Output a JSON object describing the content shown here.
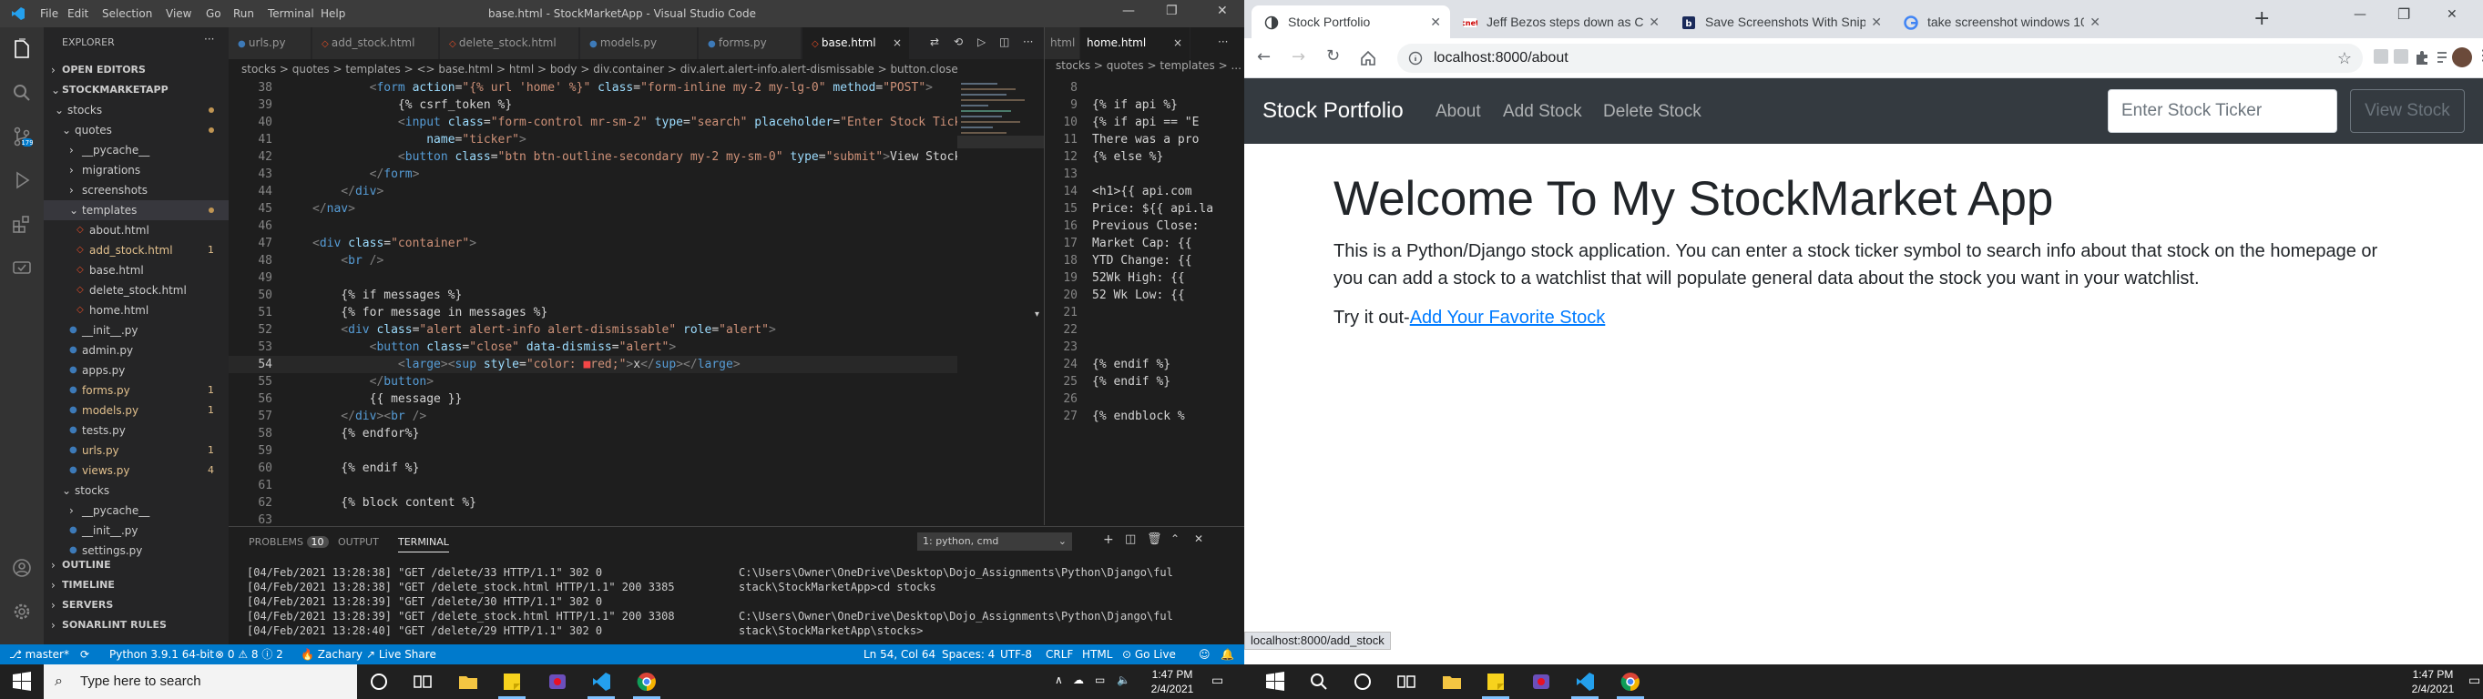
{
  "vscode": {
    "title": "base.html - StockMarketApp - Visual Studio Code",
    "menu": [
      "File",
      "Edit",
      "Selection",
      "View",
      "Go",
      "Run",
      "Terminal",
      "Help"
    ],
    "explorer": {
      "header": "EXPLORER",
      "open_editors": "OPEN EDITORS",
      "project": "STOCKMARKETAPP",
      "tree": [
        {
          "label": "stocks",
          "indent": 1,
          "type": "folder",
          "open": true,
          "dot": true
        },
        {
          "label": "quotes",
          "indent": 2,
          "type": "folder",
          "open": true,
          "dot": true
        },
        {
          "label": "__pycache__",
          "indent": 3,
          "type": "folder"
        },
        {
          "label": "migrations",
          "indent": 3,
          "type": "folder"
        },
        {
          "label": "screenshots",
          "indent": 3,
          "type": "folder"
        },
        {
          "label": "templates",
          "indent": 3,
          "type": "folder",
          "open": true,
          "dot": true,
          "selected": true
        },
        {
          "label": "about.html",
          "indent": 4,
          "type": "html"
        },
        {
          "label": "add_stock.html",
          "indent": 4,
          "type": "html",
          "badge": "1",
          "modified": true
        },
        {
          "label": "base.html",
          "indent": 4,
          "type": "html"
        },
        {
          "label": "delete_stock.html",
          "indent": 4,
          "type": "html"
        },
        {
          "label": "home.html",
          "indent": 4,
          "type": "html"
        },
        {
          "label": "__init__.py",
          "indent": 3,
          "type": "py"
        },
        {
          "label": "admin.py",
          "indent": 3,
          "type": "py"
        },
        {
          "label": "apps.py",
          "indent": 3,
          "type": "py"
        },
        {
          "label": "forms.py",
          "indent": 3,
          "type": "py",
          "badge": "1",
          "modified": true
        },
        {
          "label": "models.py",
          "indent": 3,
          "type": "py",
          "badge": "1",
          "modified": true
        },
        {
          "label": "tests.py",
          "indent": 3,
          "type": "py"
        },
        {
          "label": "urls.py",
          "indent": 3,
          "type": "py",
          "badge": "1",
          "modified": true
        },
        {
          "label": "views.py",
          "indent": 3,
          "type": "py",
          "badge": "4",
          "modified": true
        },
        {
          "label": "stocks",
          "indent": 2,
          "type": "folder",
          "open": true
        },
        {
          "label": "__pycache__",
          "indent": 3,
          "type": "folder"
        },
        {
          "label": "__init__.py",
          "indent": 3,
          "type": "py"
        },
        {
          "label": "settings.py",
          "indent": 3,
          "type": "py"
        }
      ],
      "bottom_sections": [
        "OUTLINE",
        "TIMELINE",
        "SERVERS",
        "SONARLINT RULES"
      ]
    },
    "tabs": [
      {
        "label": "urls.py",
        "kind": "py"
      },
      {
        "label": "add_stock.html",
        "kind": "html"
      },
      {
        "label": "delete_stock.html",
        "kind": "html"
      },
      {
        "label": "models.py",
        "kind": "py"
      },
      {
        "label": "forms.py",
        "kind": "py"
      },
      {
        "label": "base.html",
        "kind": "html",
        "active": true
      }
    ],
    "breadcrumb": "stocks > quotes > templates > <> base.html > html > body > div.container > div.alert.alert-info.alert-dismissable > button.close",
    "code_lines": [
      {
        "n": "38",
        "parts": [
          [
            "t",
            "        "
          ],
          [
            "t",
            "<"
          ],
          [
            "tg",
            "form"
          ],
          [
            "at",
            " action"
          ],
          [
            "tx",
            "="
          ],
          [
            "st",
            "\"{% url 'home' %}\""
          ],
          [
            "at",
            " class"
          ],
          [
            "tx",
            "="
          ],
          [
            "st",
            "\"form-inline my-2 my-lg-0\""
          ],
          [
            "at",
            " method"
          ],
          [
            "tx",
            "="
          ],
          [
            "st",
            "\"POST\""
          ],
          [
            "t",
            ">"
          ]
        ]
      },
      {
        "n": "39",
        "parts": [
          [
            "tx",
            "            {% csrf_token %}"
          ]
        ]
      },
      {
        "n": "40",
        "parts": [
          [
            "t",
            "            <"
          ],
          [
            "tg",
            "input"
          ],
          [
            "at",
            " class"
          ],
          [
            "tx",
            "="
          ],
          [
            "st",
            "\"form-control mr-sm-2\""
          ],
          [
            "at",
            " type"
          ],
          [
            "tx",
            "="
          ],
          [
            "st",
            "\"search\""
          ],
          [
            "at",
            " placeholder"
          ],
          [
            "tx",
            "="
          ],
          [
            "st",
            "\"Enter Stock Ticker\""
          ],
          [
            "at",
            " aria"
          ]
        ]
      },
      {
        "n": "41",
        "parts": [
          [
            "at",
            "                name"
          ],
          [
            "tx",
            "="
          ],
          [
            "st",
            "\"ticker\""
          ],
          [
            "t",
            ">"
          ]
        ]
      },
      {
        "n": "42",
        "parts": [
          [
            "t",
            "            <"
          ],
          [
            "tg",
            "button"
          ],
          [
            "at",
            " class"
          ],
          [
            "tx",
            "="
          ],
          [
            "st",
            "\"btn btn-outline-secondary my-2 my-sm-0\""
          ],
          [
            "at",
            " type"
          ],
          [
            "tx",
            "="
          ],
          [
            "st",
            "\"submit\""
          ],
          [
            "t",
            ">"
          ],
          [
            "tx",
            "View Stock"
          ],
          [
            "t",
            "</"
          ],
          [
            "tg",
            "bu"
          ]
        ]
      },
      {
        "n": "43",
        "parts": [
          [
            "t",
            "        </"
          ],
          [
            "tg",
            "form"
          ],
          [
            "t",
            ">"
          ]
        ]
      },
      {
        "n": "44",
        "parts": [
          [
            "t",
            "    </"
          ],
          [
            "tg",
            "div"
          ],
          [
            "t",
            ">"
          ]
        ]
      },
      {
        "n": "45",
        "parts": [
          [
            "t",
            "</"
          ],
          [
            "tg",
            "nav"
          ],
          [
            "t",
            ">"
          ]
        ]
      },
      {
        "n": "46",
        "parts": []
      },
      {
        "n": "47",
        "parts": [
          [
            "t",
            "<"
          ],
          [
            "tg",
            "div"
          ],
          [
            "at",
            " class"
          ],
          [
            "tx",
            "="
          ],
          [
            "st",
            "\"container\""
          ],
          [
            "t",
            ">"
          ]
        ]
      },
      {
        "n": "48",
        "parts": [
          [
            "t",
            "    <"
          ],
          [
            "tg",
            "br"
          ],
          [
            "t",
            " />"
          ]
        ]
      },
      {
        "n": "49",
        "parts": []
      },
      {
        "n": "50",
        "parts": [
          [
            "tx",
            "    {% if messages %}"
          ]
        ]
      },
      {
        "n": "51",
        "parts": [
          [
            "tx",
            "    {% for message in messages %}"
          ]
        ]
      },
      {
        "n": "52",
        "parts": [
          [
            "t",
            "    <"
          ],
          [
            "tg",
            "div"
          ],
          [
            "at",
            " class"
          ],
          [
            "tx",
            "="
          ],
          [
            "st",
            "\"alert alert-info alert-dismissable\""
          ],
          [
            "at",
            " role"
          ],
          [
            "tx",
            "="
          ],
          [
            "st",
            "\"alert\""
          ],
          [
            "t",
            ">"
          ]
        ]
      },
      {
        "n": "53",
        "parts": [
          [
            "t",
            "        <"
          ],
          [
            "tg",
            "button"
          ],
          [
            "at",
            " class"
          ],
          [
            "tx",
            "="
          ],
          [
            "st",
            "\"close\""
          ],
          [
            "at",
            " data-dismiss"
          ],
          [
            "tx",
            "="
          ],
          [
            "st",
            "\"alert\""
          ],
          [
            "t",
            ">"
          ]
        ]
      },
      {
        "n": "54",
        "hl": true,
        "parts": [
          [
            "t",
            "            <"
          ],
          [
            "tg",
            "large"
          ],
          [
            "t",
            "><"
          ],
          [
            "tg",
            "sup"
          ],
          [
            "at",
            " style"
          ],
          [
            "tx",
            "="
          ],
          [
            "st",
            "\"color: "
          ],
          [
            "red",
            "■"
          ],
          [
            "st",
            "red;\""
          ],
          [
            "t",
            ">"
          ],
          [
            "tx",
            "x"
          ],
          [
            "t",
            "</"
          ],
          [
            "tg",
            "sup"
          ],
          [
            "t",
            "></"
          ],
          [
            "tg",
            "large"
          ],
          [
            "t",
            ">"
          ]
        ]
      },
      {
        "n": "55",
        "parts": [
          [
            "t",
            "        </"
          ],
          [
            "tg",
            "button"
          ],
          [
            "t",
            ">"
          ]
        ]
      },
      {
        "n": "56",
        "parts": [
          [
            "tx",
            "        {{ message }}"
          ]
        ]
      },
      {
        "n": "57",
        "parts": [
          [
            "t",
            "    </"
          ],
          [
            "tg",
            "div"
          ],
          [
            "t",
            "><"
          ],
          [
            "tg",
            "br"
          ],
          [
            "t",
            " />"
          ]
        ]
      },
      {
        "n": "58",
        "parts": [
          [
            "tx",
            "    {% endfor%}"
          ]
        ]
      },
      {
        "n": "59",
        "parts": []
      },
      {
        "n": "60",
        "parts": [
          [
            "tx",
            "    {% endif %}"
          ]
        ]
      },
      {
        "n": "61",
        "parts": []
      },
      {
        "n": "62",
        "parts": [
          [
            "tx",
            "    {% block content %}"
          ]
        ]
      },
      {
        "n": "63",
        "parts": []
      }
    ],
    "split_tabs": [
      "html",
      "home.html"
    ],
    "split_breadcrumb": "stocks > quotes > templates > ...",
    "split_lines": [
      {
        "n": "8",
        "text": ""
      },
      {
        "n": "9",
        "text": "{% if api %}"
      },
      {
        "n": "10",
        "text": "{% if api == \"E"
      },
      {
        "n": "11",
        "text": "There was a pro"
      },
      {
        "n": "12",
        "text": "{% else %}"
      },
      {
        "n": "13",
        "text": ""
      },
      {
        "n": "14",
        "text": "<h1>{{ api.com"
      },
      {
        "n": "15",
        "text": "Price: ${{ api.la"
      },
      {
        "n": "16",
        "text": "Previous Close:"
      },
      {
        "n": "17",
        "text": "Market Cap: {{"
      },
      {
        "n": "18",
        "text": "YTD Change: {{"
      },
      {
        "n": "19",
        "text": "52Wk High: {{"
      },
      {
        "n": "20",
        "text": "52 Wk Low: {{"
      },
      {
        "n": "21",
        "text": ""
      },
      {
        "n": "22",
        "text": ""
      },
      {
        "n": "23",
        "text": ""
      },
      {
        "n": "24",
        "text": "{% endif %}"
      },
      {
        "n": "25",
        "text": "{% endif %}"
      },
      {
        "n": "26",
        "text": ""
      },
      {
        "n": "27",
        "text": "{% endblock %"
      }
    ],
    "panel": {
      "tabs": [
        "PROBLEMS",
        "OUTPUT",
        "TERMINAL"
      ],
      "problems_count": "10",
      "shell_select": "1: python, cmd",
      "left_lines": [
        "[04/Feb/2021 13:28:38] \"GET /delete/33 HTTP/1.1\" 302 0",
        "[04/Feb/2021 13:28:38] \"GET /delete_stock.html HTTP/1.1\" 200 3385",
        "[04/Feb/2021 13:28:39] \"GET /delete/30 HTTP/1.1\" 302 0",
        "[04/Feb/2021 13:28:39] \"GET /delete_stock.html HTTP/1.1\" 200 3308",
        "[04/Feb/2021 13:28:40] \"GET /delete/29 HTTP/1.1\" 302 0"
      ],
      "right_lines": [
        "C:\\Users\\Owner\\OneDrive\\Desktop\\Dojo_Assignments\\Python\\Django\\ful",
        "stack\\StockMarketApp>cd stocks",
        "",
        "C:\\Users\\Owner\\OneDrive\\Desktop\\Dojo_Assignments\\Python\\Django\\ful",
        "stack\\StockMarketApp\\stocks>"
      ]
    },
    "status": {
      "branch": "master*",
      "python": "Python 3.9.1 64-bit",
      "problems": "⊗ 0 ⚠ 8 ⓘ 2",
      "user": "Zachary",
      "liveshare": "Live Share",
      "position": "Ln 54, Col 64",
      "spaces": "Spaces: 4",
      "encoding": "UTF-8",
      "eol": "CRLF",
      "lang": "HTML",
      "golive": "Go Live"
    }
  },
  "chrome": {
    "tabs": [
      {
        "title": "Stock Portfolio",
        "active": true
      },
      {
        "title": "Jeff Bezos steps down as CE"
      },
      {
        "title": "Save Screenshots With Snip"
      },
      {
        "title": "take screenshot windows 10"
      }
    ],
    "url": "localhost:8000/about",
    "status_url": "localhost:8000/add_stock",
    "site": {
      "brand": "Stock Portfolio",
      "nav": [
        "About",
        "Add Stock",
        "Delete Stock"
      ],
      "search_placeholder": "Enter Stock Ticker",
      "search_button": "View Stock",
      "heading": "Welcome To My StockMarket App",
      "paragraph": "This is a Python/Django stock application. You can enter a stock ticker symbol to search info about that stock on the homepage or you can add a stock to a watchlist that will populate general data about the stock you want in your watchlist.",
      "try_prefix": "Try it out-",
      "try_link": "Add Your Favorite Stock"
    }
  },
  "taskbar_left": {
    "search_placeholder": "Type here to search",
    "time": "1:47 PM",
    "date": "2/4/2021"
  },
  "taskbar_right": {
    "time": "1:47 PM",
    "date": "2/4/2021"
  },
  "colors": {
    "vscode_status": "#007acc",
    "bootstrap_dark": "#343a40",
    "link": "#007bff"
  }
}
